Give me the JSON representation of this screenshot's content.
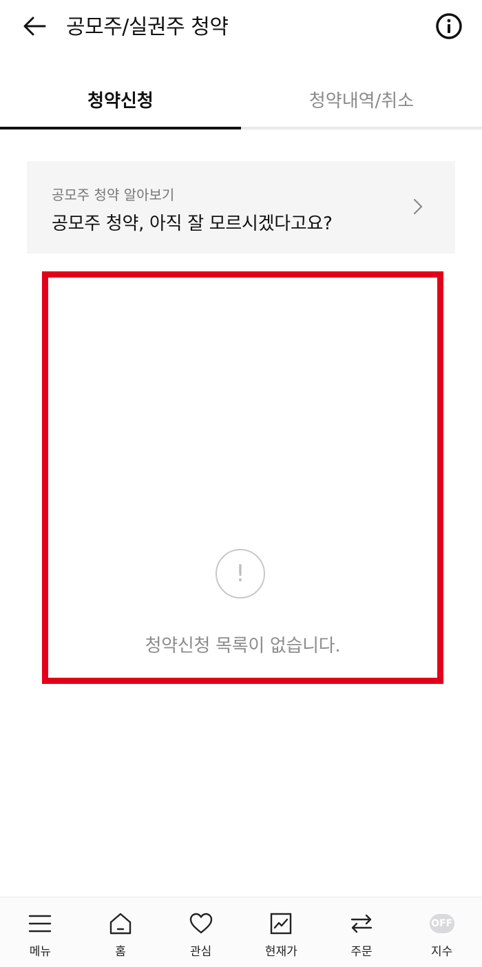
{
  "header": {
    "title": "공모주/실권주 청약",
    "back_icon": "arrow-left-icon",
    "info_icon": "info-circle-icon"
  },
  "tabs": [
    {
      "label": "청약신청",
      "active": true
    },
    {
      "label": "청약내역/취소",
      "active": false
    }
  ],
  "banner": {
    "subtitle": "공모주 청약 알아보기",
    "title": "공모주 청약, 아직 잘 모르시겠다고요?",
    "chevron_icon": "chevron-right-icon"
  },
  "empty_state": {
    "icon": "exclamation-circle-icon",
    "icon_glyph": "!",
    "message": "청약신청 목록이 없습니다.",
    "highlight_color": "#e3001b"
  },
  "bottom_nav": {
    "items": [
      {
        "label": "메뉴",
        "icon": "hamburger-menu-icon"
      },
      {
        "label": "홈",
        "icon": "home-icon"
      },
      {
        "label": "관심",
        "icon": "heart-icon"
      },
      {
        "label": "현재가",
        "icon": "chart-icon"
      },
      {
        "label": "주문",
        "icon": "swap-arrows-icon"
      },
      {
        "label": "지수",
        "icon": "off-toggle",
        "badge": "OFF"
      }
    ]
  }
}
